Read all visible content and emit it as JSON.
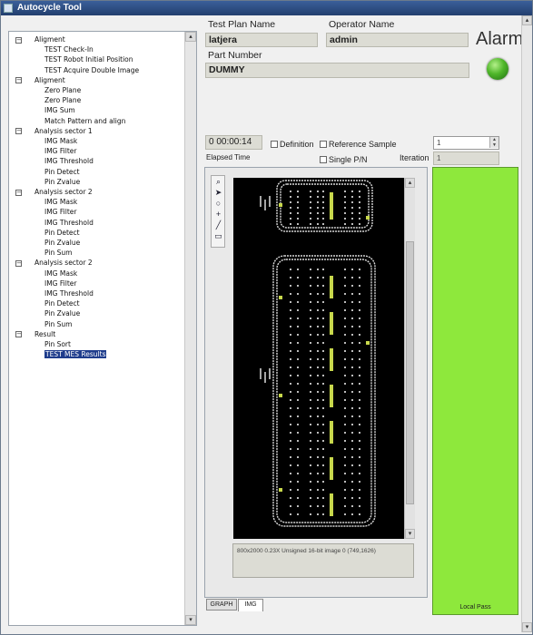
{
  "window": {
    "title": "Autocycle Tool"
  },
  "tree": {
    "nodes": [
      {
        "label": "Aligment",
        "level": 0,
        "expander": "−"
      },
      {
        "label": "TEST Check-In",
        "level": 1
      },
      {
        "label": "TEST Robot Initial Position",
        "level": 1
      },
      {
        "label": "TEST Acquire Double Image",
        "level": 1
      },
      {
        "label": "Aligment",
        "level": 0,
        "expander": "−"
      },
      {
        "label": "Zero Plane",
        "level": 1
      },
      {
        "label": "Zero Plane",
        "level": 1
      },
      {
        "label": "IMG Sum",
        "level": 1
      },
      {
        "label": "Match Pattern and align",
        "level": 1
      },
      {
        "label": "Analysis sector 1",
        "level": 0,
        "expander": "−"
      },
      {
        "label": "IMG Mask",
        "level": 1
      },
      {
        "label": "IMG Filter",
        "level": 1
      },
      {
        "label": "IMG Threshold",
        "level": 1
      },
      {
        "label": "Pin Detect",
        "level": 1
      },
      {
        "label": "Pin Zvalue",
        "level": 1
      },
      {
        "label": "Analysis sector 2",
        "level": 0,
        "expander": "−"
      },
      {
        "label": "IMG Mask",
        "level": 1
      },
      {
        "label": "IMG Filter",
        "level": 1
      },
      {
        "label": "IMG Threshold",
        "level": 1
      },
      {
        "label": "Pin Detect",
        "level": 1
      },
      {
        "label": "Pin Zvalue",
        "level": 1
      },
      {
        "label": "Pin Sum",
        "level": 1
      },
      {
        "label": "Analysis sector 2",
        "level": 0,
        "expander": "−"
      },
      {
        "label": "IMG Mask",
        "level": 1
      },
      {
        "label": "IMG Filter",
        "level": 1
      },
      {
        "label": "IMG Threshold",
        "level": 1
      },
      {
        "label": "Pin Detect",
        "level": 1
      },
      {
        "label": "Pin Zvalue",
        "level": 1
      },
      {
        "label": "Pin Sum",
        "level": 1
      },
      {
        "label": "Result",
        "level": 0,
        "expander": "−"
      },
      {
        "label": "Pin Sort",
        "level": 1
      },
      {
        "label": "TEST MES Results",
        "level": 1,
        "selected": true
      }
    ]
  },
  "form": {
    "test_plan_label": "Test Plan Name",
    "test_plan_value": "latjera",
    "operator_label": "Operator Name",
    "operator_value": "admin",
    "part_number_label": "Part Number",
    "part_number_value": "DUMMY",
    "alarm_label": "Alarm",
    "alarm_color": "#4fb62a"
  },
  "run": {
    "elapsed_value": "0  00:00:14",
    "elapsed_label": "Elapsed Time",
    "definition_label": "Definition",
    "reference_sample_label": "Reference Sample",
    "single_pn_label": "Single P/N",
    "iteration_label": "Iteration",
    "iteration_spin_value": "1",
    "iteration_value": "1"
  },
  "viewer": {
    "tools": [
      "magnifier-icon",
      "pointer-icon",
      "circle-icon",
      "crosshair-icon",
      "line-icon",
      "rectangle-icon"
    ],
    "info": "800x2000 0.23X Unsigned 16-bit image 0   (749,1626)",
    "tabs": [
      "GRAPH",
      "IMG"
    ],
    "active_tab": "IMG"
  },
  "status": {
    "label": "Local Pass",
    "color": "#8ee83c"
  }
}
